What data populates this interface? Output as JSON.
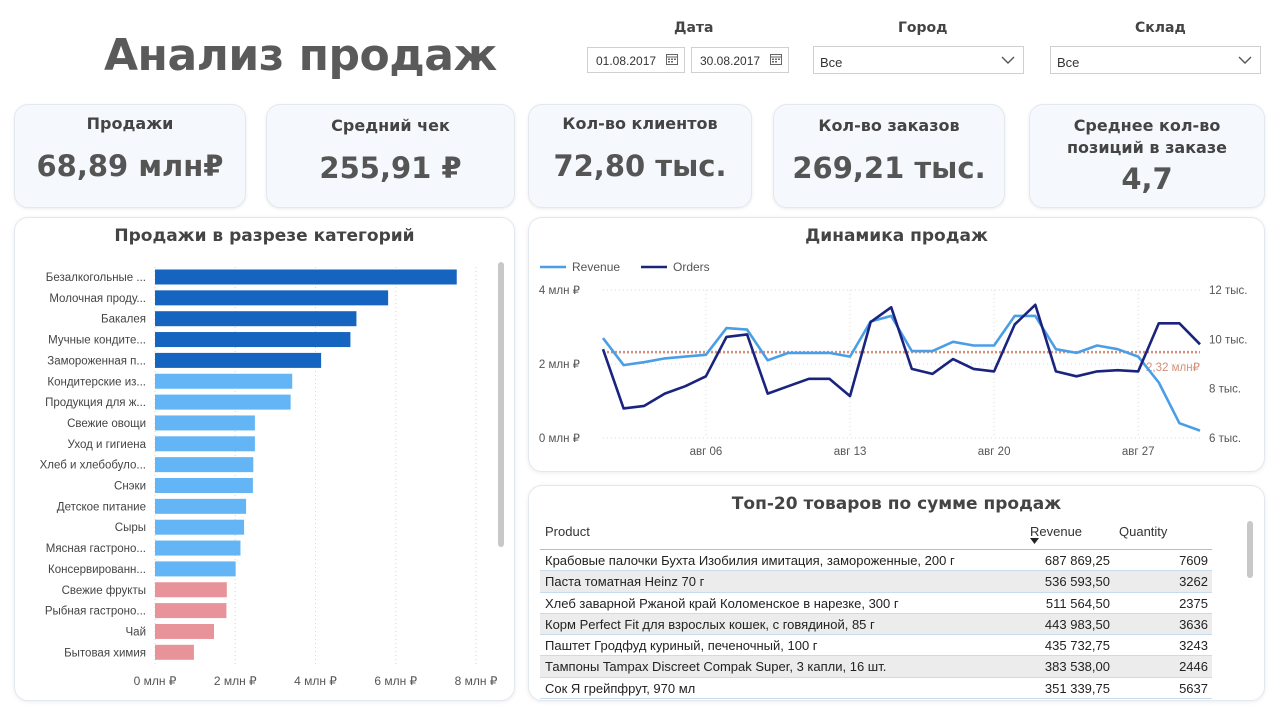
{
  "header": {
    "title": "Анализ продаж",
    "filters": {
      "date_label": "Дата",
      "date_from": "01.08.2017",
      "date_to": "30.08.2017",
      "city_label": "Город",
      "city_value": "Все",
      "warehouse_label": "Склад",
      "warehouse_value": "Все"
    }
  },
  "kpis": [
    {
      "label": "Продажи",
      "value": "68,89 млн₽"
    },
    {
      "label": "Средний чек",
      "value": "255,91 ₽"
    },
    {
      "label": "Кол-во клиентов",
      "value": "72,80 тыс."
    },
    {
      "label": "Кол-во заказов",
      "value": "269,21 тыс."
    },
    {
      "label": "Среднее кол-во позиций в заказе",
      "value": "4,7"
    }
  ],
  "chart_data": [
    {
      "type": "bar",
      "orientation": "horizontal",
      "title": "Продажи в разрезе категорий",
      "categories": [
        "Безалкогольные ...",
        "Молочная проду...",
        "Бакалея",
        "Мучные кондите...",
        "Замороженная п...",
        "Кондитерские из...",
        "Продукция для ж...",
        "Свежие овощи",
        "Уход и гигиена",
        "Хлеб и хлебобуло...",
        "Снэки",
        "Детское питание",
        "Сыры",
        "Мясная гастроно...",
        "Консервированн...",
        "Свежие фрукты",
        "Рыбная гастроно...",
        "Чай",
        "Бытовая химия"
      ],
      "values": [
        7.52,
        5.81,
        5.02,
        4.87,
        4.14,
        3.42,
        3.38,
        2.49,
        2.49,
        2.45,
        2.44,
        2.27,
        2.22,
        2.13,
        2.01,
        1.79,
        1.78,
        1.47,
        0.97
      ],
      "colors": [
        "#1565c0",
        "#1565c0",
        "#1565c0",
        "#1565c0",
        "#1565c0",
        "#64b5f6",
        "#64b5f6",
        "#64b5f6",
        "#64b5f6",
        "#64b5f6",
        "#64b5f6",
        "#64b5f6",
        "#64b5f6",
        "#64b5f6",
        "#64b5f6",
        "#e8939a",
        "#e8939a",
        "#e8939a",
        "#e8939a"
      ],
      "xlim": [
        0,
        8
      ],
      "xticks": [
        0,
        2,
        4,
        6,
        8
      ],
      "xtick_labels": [
        "0 млн ₽",
        "2 млн ₽",
        "4 млн ₽",
        "6 млн ₽",
        "8 млн ₽"
      ],
      "grid": true
    },
    {
      "type": "line",
      "title": "Динамика продаж",
      "x": [
        "2017-08-01",
        "2017-08-02",
        "2017-08-03",
        "2017-08-04",
        "2017-08-05",
        "2017-08-06",
        "2017-08-07",
        "2017-08-08",
        "2017-08-09",
        "2017-08-10",
        "2017-08-11",
        "2017-08-12",
        "2017-08-13",
        "2017-08-14",
        "2017-08-15",
        "2017-08-16",
        "2017-08-17",
        "2017-08-18",
        "2017-08-19",
        "2017-08-20",
        "2017-08-21",
        "2017-08-22",
        "2017-08-23",
        "2017-08-24",
        "2017-08-25",
        "2017-08-26",
        "2017-08-27",
        "2017-08-28",
        "2017-08-29",
        "2017-08-30"
      ],
      "series": [
        {
          "name": "Revenue",
          "axis": "left",
          "color": "#4a9ee8",
          "values": [
            2.7,
            1.97,
            2.05,
            2.15,
            2.2,
            2.25,
            2.97,
            2.93,
            2.1,
            2.3,
            2.3,
            2.3,
            2.2,
            3.15,
            3.3,
            2.35,
            2.35,
            2.6,
            2.5,
            2.5,
            3.3,
            3.3,
            2.4,
            2.3,
            2.5,
            2.4,
            2.2,
            1.5,
            0.4,
            0.2
          ]
        },
        {
          "name": "Orders",
          "axis": "right",
          "color": "#1a237e",
          "values": [
            9.6,
            7.2,
            7.3,
            7.8,
            8.1,
            8.5,
            10.1,
            10.2,
            7.8,
            8.1,
            8.4,
            8.4,
            7.7,
            10.7,
            11.3,
            8.8,
            8.6,
            9.2,
            8.8,
            8.7,
            10.6,
            11.4,
            8.7,
            8.5,
            8.7,
            8.75,
            8.7,
            10.65,
            10.65,
            9.8
          ]
        }
      ],
      "reference_line": {
        "value": 2.32,
        "axis": "left",
        "label": "2,32 млн₽",
        "color": "#d4907a"
      },
      "y_left": {
        "range": [
          0,
          4
        ],
        "ticks": [
          0,
          2,
          4
        ],
        "tick_labels": [
          "0 млн ₽",
          "2 млн ₽",
          "4 млн ₽"
        ]
      },
      "y_right": {
        "range": [
          6,
          12
        ],
        "ticks": [
          6,
          8,
          10,
          12
        ],
        "tick_labels": [
          "6 тыс.",
          "8 тыс.",
          "10 тыс.",
          "12 тыс."
        ]
      },
      "xtick_dates": [
        "2017-08-06",
        "2017-08-13",
        "2017-08-20",
        "2017-08-27"
      ],
      "xtick_labels": [
        "авг 06",
        "авг 13",
        "авг 20",
        "авг 27"
      ],
      "legend": "top-left",
      "grid": true
    },
    {
      "type": "table",
      "title": "Топ-20 товаров по сумме продаж",
      "columns": [
        "Product",
        "Revenue",
        "Quantity"
      ],
      "sort_column": "Revenue",
      "rows": [
        [
          "Крабовые палочки Бухта Изобилия имитация, замороженные, 200 г",
          "687 869,25",
          "7609"
        ],
        [
          "Паста томатная Heinz 70 г",
          "536 593,50",
          "3262"
        ],
        [
          "Хлеб заварной Ржаной край Коломенское в нарезке, 300 г",
          "511 564,50",
          "2375"
        ],
        [
          "Корм Perfect Fit для взрослых кошек, с говядиной, 85 г",
          "443 983,50",
          "3636"
        ],
        [
          "Паштет Гродфуд куриный, печеночный, 100 г",
          "435 732,75",
          "3243"
        ],
        [
          "Тампоны Tampax Discreet Compak Super, 3 капли, 16 шт.",
          "383 538,00",
          "2446"
        ],
        [
          "Сок Я грейпфрут, 970 мл",
          "351 339,75",
          "5637"
        ]
      ]
    }
  ]
}
